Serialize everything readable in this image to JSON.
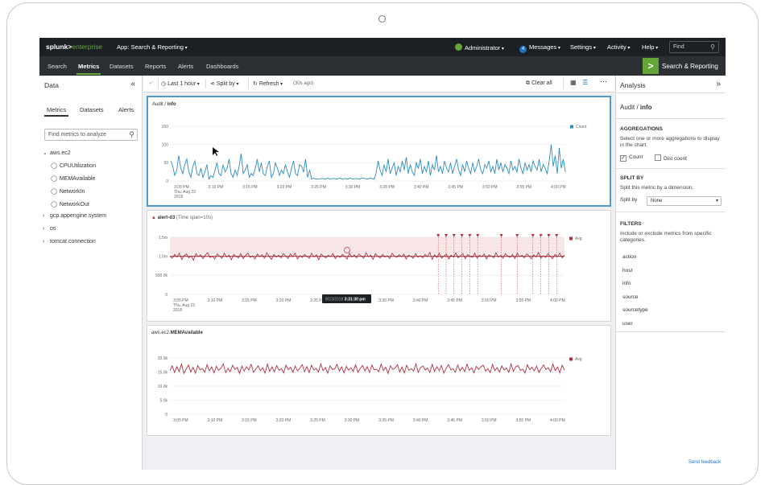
{
  "topbar": {
    "logo_main": "splunk>",
    "logo_ent": "enterprise",
    "app": "App: Search & Reporting",
    "user": "Administrator",
    "messages_count": "4",
    "messages": "Messages",
    "settings": "Settings",
    "activity": "Activity",
    "help": "Help",
    "find_placeholder": "Find",
    "brand_green": "#65a637"
  },
  "nav": {
    "items": [
      "Search",
      "Metrics",
      "Datasets",
      "Reports",
      "Alerts",
      "Dashboards"
    ],
    "active": "Metrics",
    "app_badge": "Search & Reporting"
  },
  "left": {
    "title": "Data",
    "tabs": [
      "Metrics",
      "Datasets",
      "Alerts"
    ],
    "search_placeholder": "Find metrics to analyze",
    "tree": [
      {
        "label": "aws.ec2",
        "expanded": true
      },
      {
        "label": "CPUUtilization",
        "child": true
      },
      {
        "label": "MEMAvailable",
        "child": true
      },
      {
        "label": "NetworkIn",
        "child": true
      },
      {
        "label": "NetworkOut",
        "child": true
      },
      {
        "label": "gcp.appengine.system",
        "expanded": false
      },
      {
        "label": "os",
        "expanded": false
      },
      {
        "label": "tomcat.connection",
        "expanded": false
      }
    ]
  },
  "toolbar": {
    "time": "Last 1 hour",
    "split": "Split by",
    "refresh": "Refresh",
    "refresh_age": "(30s ago)",
    "clear": "Clear all"
  },
  "panels": {
    "p1": {
      "title_prefix": "Audit / ",
      "title_bold": "info",
      "legend": "Count",
      "color": "#2e8bc0"
    },
    "p2": {
      "title_bold": "alert-d3",
      "title_suffix": "(Time span=10s)",
      "legend": "Avg",
      "color": "#b0313e",
      "tooltip_date": "8/23/2018",
      "tooltip_time": "3:31:30 pm"
    },
    "p3": {
      "title_prefix": "aws.ec2.",
      "title_bold": "MEMAvailable",
      "legend": "Avg",
      "color": "#b0313e"
    }
  },
  "chart_data": [
    {
      "type": "line",
      "title": "Audit / info",
      "series": [
        {
          "name": "Count",
          "values": [
            55,
            40,
            15,
            30,
            70,
            35,
            20,
            45,
            60,
            25,
            10,
            40,
            55,
            20,
            15,
            35,
            10,
            25,
            45,
            5,
            15,
            10,
            30,
            50,
            20,
            15,
            45,
            25,
            35,
            60,
            20,
            10,
            30,
            15,
            40,
            75,
            20,
            30,
            45,
            10,
            20,
            15,
            35,
            60,
            25,
            50,
            20,
            15,
            40,
            55,
            10,
            20,
            50,
            35,
            15,
            30,
            20,
            45,
            25,
            10,
            35,
            55,
            20,
            15,
            45,
            40,
            25,
            60,
            10,
            30,
            5,
            8,
            5,
            6,
            5,
            7,
            6,
            5,
            8,
            5,
            6,
            7,
            5,
            6,
            8,
            5,
            6,
            7,
            5,
            8,
            6,
            5,
            7,
            6,
            5,
            8,
            7,
            6,
            5,
            8,
            6,
            5,
            20,
            55,
            30,
            15,
            45,
            25,
            60,
            20,
            35,
            50,
            15,
            40,
            25,
            55,
            30,
            65,
            20,
            45,
            25,
            15,
            50,
            35,
            60,
            20,
            40,
            25,
            55,
            15,
            45,
            30,
            70,
            25,
            40,
            20,
            55,
            35,
            25,
            50,
            20,
            40,
            60,
            30,
            15,
            45,
            25,
            55,
            35,
            20,
            50,
            25,
            40,
            60,
            30,
            20,
            45,
            35,
            55,
            25,
            40,
            20,
            60,
            30,
            50,
            25,
            45,
            35,
            20,
            55,
            30,
            40,
            25,
            60,
            35,
            20,
            50,
            30,
            45,
            25,
            55,
            40,
            30,
            60,
            25,
            45,
            35,
            20,
            55,
            100,
            40,
            70,
            20,
            90,
            35,
            60,
            25
          ]
        }
      ],
      "x_ticks": [
        "3:05 PM",
        "3:10 PM",
        "3:15 PM",
        "3:20 PM",
        "3:25 PM",
        "3:30 PM",
        "3:35 PM",
        "3:40 PM",
        "3:45 PM",
        "3:50 PM",
        "3:55 PM",
        "4:00 PM"
      ],
      "x_first_sub": [
        "Thu, Aug 23",
        "2018"
      ],
      "ylim": [
        0,
        150
      ],
      "y_ticks": [
        "150",
        "100",
        "50",
        "0"
      ]
    },
    {
      "type": "line",
      "title": "alert-d3",
      "series": [
        {
          "name": "Avg",
          "values": [
            1.0,
            0.95,
            1.05,
            0.98,
            1.08,
            0.92,
            1.02,
            1.06,
            0.96,
            1.01,
            0.9,
            1.07,
            0.99,
            1.04,
            0.94,
            1.03,
            1.09,
            0.97,
            1.0,
            0.93,
            1.06,
            1.01,
            0.95,
            1.08,
            0.98,
            1.03,
            0.91,
            1.05,
            1.0,
            0.96,
            1.07,
            0.94,
            1.02,
            1.08,
            0.97,
            1.01,
            0.93,
            1.06,
            0.99,
            1.04,
            0.95,
            1.09,
            1.0,
            0.92,
            1.05,
            0.98,
            1.03,
            0.96,
            1.07,
            1.01,
            0.94,
            1.06,
            0.99,
            1.08,
            0.93,
            1.02,
            0.97,
            1.05,
            1.0,
            0.95,
            1.08,
            0.98,
            1.04,
            0.91,
            1.06,
            1.01,
            0.96,
            1.03,
            0.99,
            1.07,
            0.94,
            1.02,
            0.97,
            1.05,
            1.0,
            0.93,
            1.08,
            0.98,
            1.04,
            0.96,
            1.06,
            1.01,
            0.95,
            1.09,
            0.99,
            1.03,
            0.92,
            1.07,
            1.0,
            0.96,
            1.05,
            0.98,
            1.02,
            0.94,
            1.08,
            1.01,
            0.97,
            1.04,
            0.99,
            1.06,
            0.93,
            1.03,
            1.0,
            0.95,
            1.07,
            0.98,
            1.02,
            0.96,
            1.05,
            0.99,
            1.1,
            0.92,
            1.04,
            0.97,
            1.08,
            0.95,
            1.01,
            1.06,
            0.93,
            1.03,
            0.98,
            1.09,
            0.96,
            1.02,
            1.07,
            0.94,
            1.05,
            1.0,
            0.97,
            1.08,
            0.95,
            1.03,
            0.99,
            1.06,
            0.93,
            1.04,
            1.01,
            0.96,
            1.09,
            0.98,
            1.02,
            0.95,
            1.07,
            1.0,
            0.97,
            1.05,
            0.94,
            1.08,
            0.99,
            1.03,
            0.96,
            1.06,
            1.01,
            0.93,
            1.04,
            0.98,
            1.1,
            0.95,
            1.02,
            0.97,
            1.07,
            1.0,
            0.94,
            1.05,
            0.99,
            1.08,
            0.96,
            1.03
          ]
        }
      ],
      "threshold": 1.0,
      "x_ticks": [
        "3:05 PM",
        "3:10 PM",
        "3:15 PM",
        "3:20 PM",
        "3:25 PM",
        "3:30 PM",
        "3:35 PM",
        "3:40 PM",
        "3:45 PM",
        "3:50 PM",
        "3:55 PM",
        "4:00 PM"
      ],
      "x_first_sub": [
        "Thu, Aug 23",
        "2018"
      ],
      "ylim": [
        0,
        1500000
      ],
      "y_ticks": [
        "1.5m",
        "1.0m",
        "500.0k",
        "0"
      ]
    },
    {
      "type": "line",
      "title": "aws.ec2.MEMAvailable",
      "series": [
        {
          "name": "Avg",
          "values": [
            15.5,
            17.2,
            14.8,
            16.9,
            15.2,
            17.8,
            14.5,
            16.1,
            17.5,
            15.0,
            16.7,
            14.6,
            17.3,
            15.8,
            16.2,
            14.9,
            17.6,
            15.4,
            16.8,
            14.7,
            17.0,
            15.6,
            16.4,
            17.9,
            14.8,
            16.3,
            15.1,
            17.4,
            15.9,
            16.6,
            14.5,
            17.1,
            15.3,
            16.9,
            15.7,
            17.7,
            14.9,
            16.0,
            17.2,
            15.5,
            16.5,
            14.6,
            17.8,
            15.2,
            16.8,
            15.0,
            17.3,
            15.6,
            16.2,
            14.7,
            17.5,
            15.8,
            16.7,
            14.9,
            17.1,
            15.4,
            16.4,
            17.6,
            15.1,
            16.9,
            14.8,
            17.4,
            15.7,
            16.3,
            15.0,
            17.9,
            15.5,
            16.6,
            14.6,
            17.2,
            15.9,
            16.1,
            17.7,
            15.3,
            16.8,
            14.7,
            17.0,
            15.6,
            16.5,
            15.2,
            17.6,
            14.9,
            16.3,
            17.3,
            15.4,
            16.9,
            14.8,
            17.5,
            15.8,
            16.0,
            15.1,
            17.8,
            15.5,
            16.7,
            14.5,
            17.2,
            15.9,
            16.4,
            17.6,
            15.0,
            16.8,
            14.7,
            17.4,
            15.6,
            16.2,
            15.3,
            17.9,
            14.9,
            16.6,
            17.1,
            15.7,
            16.4,
            14.8,
            17.7,
            15.2,
            16.9,
            15.5,
            17.3,
            14.6,
            16.3,
            17.6,
            15.8,
            16.1,
            14.9,
            17.5,
            15.4,
            16.7,
            15.1,
            17.8,
            15.6,
            16.5,
            14.7,
            17.0,
            15.9,
            16.8,
            17.4,
            15.3,
            16.2,
            14.8,
            17.7,
            15.5,
            16.6,
            15.0,
            17.2,
            15.7,
            16.4,
            14.9,
            17.9,
            15.2,
            16.9,
            17.3,
            15.6,
            16.0,
            14.6,
            17.6,
            15.8,
            16.7,
            15.4,
            17.1,
            14.8,
            16.3,
            17.5,
            15.9,
            16.5,
            15.1,
            17.8,
            15.5,
            16.8,
            14.7,
            17.4,
            15.6
          ]
        }
      ],
      "x_ticks": [
        "3:05 PM",
        "3:10 PM",
        "3:15 PM",
        "3:20 PM",
        "3:25 PM",
        "3:30 PM",
        "3:35 PM",
        "3:40 PM",
        "3:45 PM",
        "3:50 PM",
        "3:55 PM",
        "4:00 PM"
      ],
      "ylim": [
        0,
        20000
      ],
      "y_ticks": [
        "20.0k",
        "15.0k",
        "10.0k",
        "5.0k",
        "0"
      ]
    }
  ],
  "right": {
    "title": "Analysis",
    "crumb_prefix": "Audit / ",
    "crumb_bold": "info",
    "aggregations_h": "AGGREGATIONS",
    "aggregations_txt": "Select one or more aggregations to display in the chart.",
    "agg_count": "Count",
    "agg_dc": "Dist count",
    "split_h": "SPLIT BY",
    "split_txt": "Split this metric by a dimension.",
    "split_label": "Split by",
    "split_value": "None",
    "filters_h": "FILTERS",
    "filters_txt": "Include or exclude metrics from specific categories.",
    "filters": [
      "action",
      "host",
      "info",
      "source",
      "sourcetype",
      "user"
    ],
    "feedback": "Send feedback"
  }
}
